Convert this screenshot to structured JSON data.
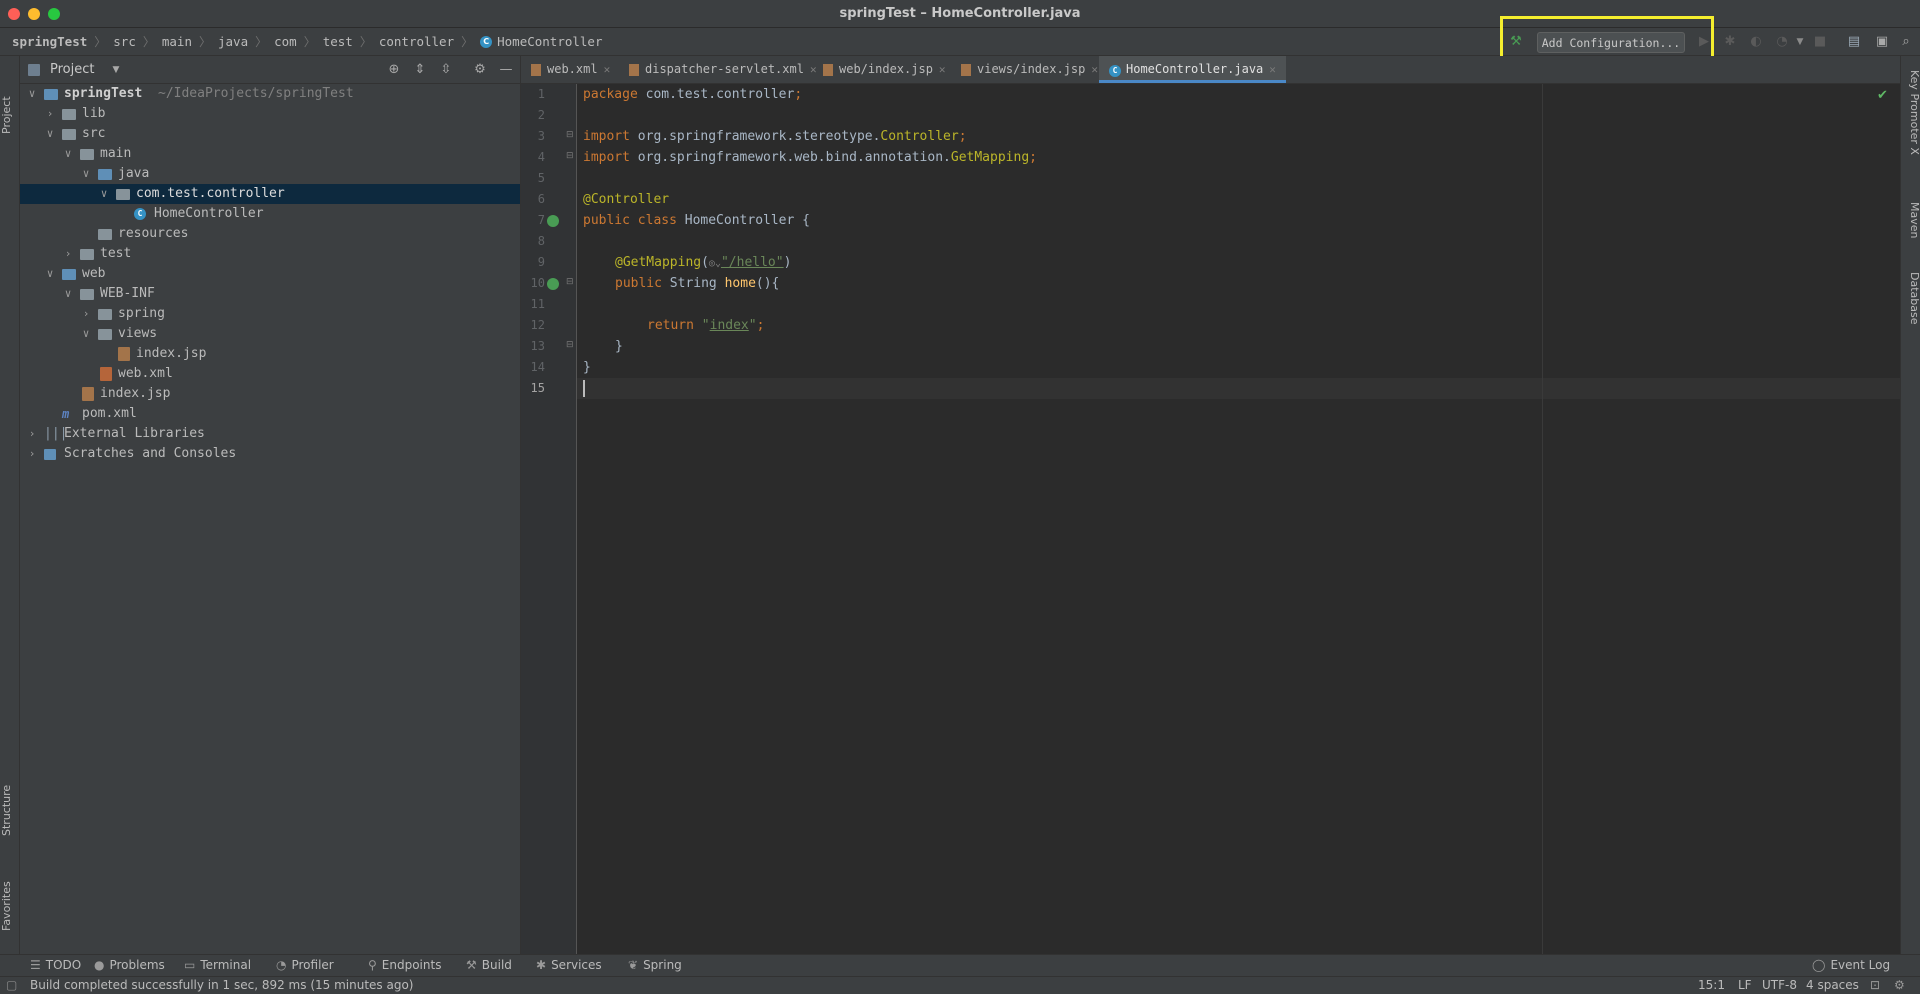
{
  "window": {
    "title": "springTest – HomeController.java"
  },
  "breadcrumbs": [
    "springTest",
    "src",
    "main",
    "java",
    "com",
    "test",
    "controller",
    "HomeController"
  ],
  "toolbar": {
    "add_config_label": "Add Configuration..."
  },
  "project_panel": {
    "title": "Project",
    "tree": [
      {
        "label": "springTest",
        "extra": "~/IdeaProjects/springTest"
      },
      {
        "label": "lib"
      },
      {
        "label": "src"
      },
      {
        "label": "main"
      },
      {
        "label": "java"
      },
      {
        "label": "com.test.controller"
      },
      {
        "label": "HomeController"
      },
      {
        "label": "resources"
      },
      {
        "label": "test"
      },
      {
        "label": "web"
      },
      {
        "label": "WEB-INF"
      },
      {
        "label": "spring"
      },
      {
        "label": "views"
      },
      {
        "label": "index.jsp"
      },
      {
        "label": "web.xml"
      },
      {
        "label": "index.jsp"
      },
      {
        "label": "pom.xml"
      },
      {
        "label": "External Libraries"
      },
      {
        "label": "Scratches and Consoles"
      }
    ]
  },
  "editor_tabs": [
    "web.xml",
    "dispatcher-servlet.xml",
    "web/index.jsp",
    "views/index.jsp",
    "HomeController.java"
  ],
  "code": {
    "line_numbers": [
      "1",
      "2",
      "3",
      "4",
      "5",
      "6",
      "7",
      "8",
      "9",
      "10",
      "11",
      "12",
      "13",
      "14",
      "15"
    ],
    "l1_kw": "package",
    "l1_rest": " com.test.controller",
    "l1_semi": ";",
    "l3_kw": "import",
    "l3_rest": " org.springframework.stereotype.",
    "l3_cls": "Controller",
    "l3_semi": ";",
    "l4_kw": "import",
    "l4_rest": " org.springframework.web.bind.annotation.",
    "l4_cls": "GetMapping",
    "l4_semi": ";",
    "l6_ann": "@Controller",
    "l7_kw": "public class",
    "l7_rest": " HomeController {",
    "l9_ann": "@GetMapping",
    "l9_open": "(",
    "l9_str": "\"/hello\"",
    "l9_close": ")",
    "l10_kw": "public",
    "l10_type": " String ",
    "l10_fn": "home",
    "l10_rest": "(){",
    "l12_kw": "return",
    "l12_str_open": " \"",
    "l12_str": "index",
    "l12_str_close": "\"",
    "l12_semi": ";",
    "l13": "}",
    "l14": "}"
  },
  "left_tabs": {
    "project": "Project",
    "structure": "Structure",
    "favorites": "Favorites"
  },
  "right_tabs": {
    "key_promoter": "Key Promoter X",
    "maven": "Maven",
    "database": "Database"
  },
  "bottom_tools": [
    "TODO",
    "Problems",
    "Terminal",
    "Profiler",
    "Endpoints",
    "Build",
    "Services",
    "Spring"
  ],
  "event_log": "Event Log",
  "status": {
    "message": "Build completed successfully in 1 sec, 892 ms (15 minutes ago)",
    "position": "15:1",
    "line_sep": "LF",
    "encoding": "UTF-8",
    "indent": "4 spaces"
  }
}
